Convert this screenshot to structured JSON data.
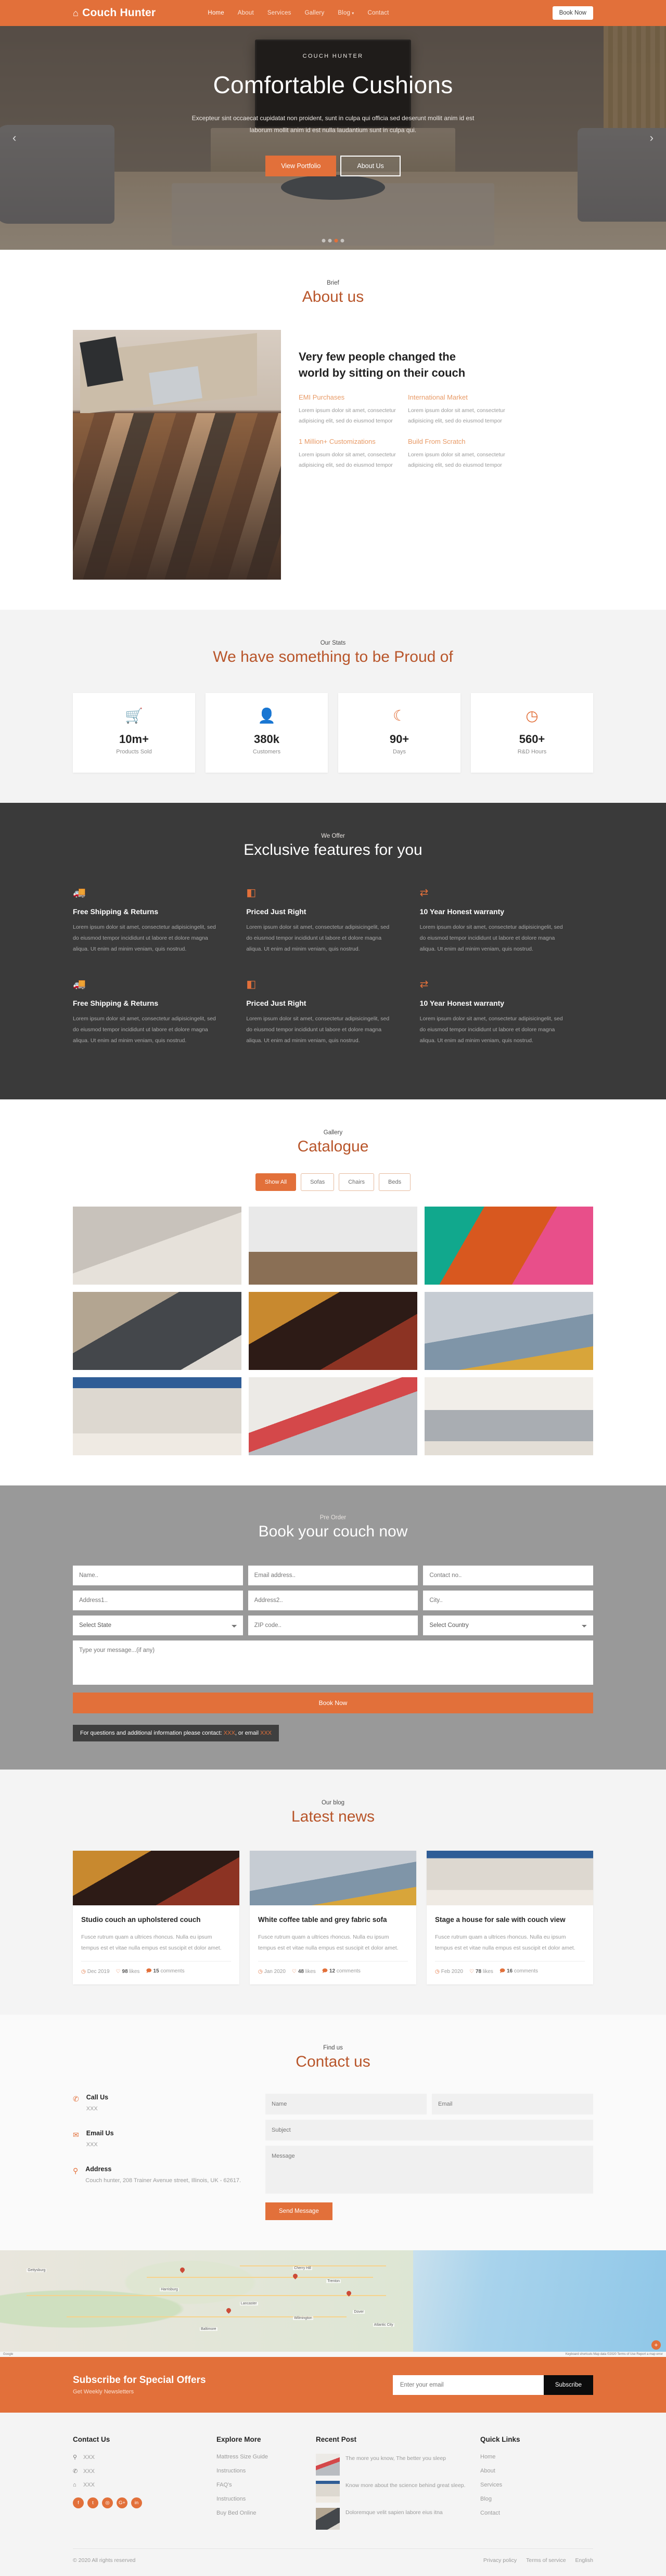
{
  "header": {
    "brand": "Couch Hunter",
    "brand_icon": "home-icon",
    "nav": [
      {
        "label": "Home",
        "active": true
      },
      {
        "label": "About",
        "active": false
      },
      {
        "label": "Services",
        "active": false
      },
      {
        "label": "Gallery",
        "active": false
      },
      {
        "label": "Blog",
        "active": false,
        "caret": "▾"
      },
      {
        "label": "Contact",
        "active": false
      }
    ],
    "book_now": "Book Now"
  },
  "hero": {
    "kicker": "COUCH HUNTER",
    "title": "Comfortable Cushions",
    "subtitle": "Excepteur sint occaecat cupidatat non proident, sunt in culpa qui officia sed deserunt mollit anim id est laborum mollit anim id est nulla laudantium sunt in culpa qui.",
    "primary_btn": "View Portfolio",
    "secondary_btn": "About Us",
    "prev": "‹",
    "next": "›",
    "slide_count": 4,
    "active_slide": 3
  },
  "about": {
    "kicker": "Brief",
    "headline": "About us",
    "heading": "Very few people changed the world by sitting on their couch",
    "cells": [
      {
        "title": "EMI Purchases",
        "text": "Lorem ipsum dolor sit amet, consectetur adipisicing elit, sed do eiusmod tempor"
      },
      {
        "title": "International Market",
        "text": "Lorem ipsum dolor sit amet, consectetur adipisicing elit, sed do eiusmod tempor"
      },
      {
        "title": "1 Million+ Customizations",
        "text": "Lorem ipsum dolor sit amet, consectetur adipisicing elit, sed do eiusmod tempor"
      },
      {
        "title": "Build From Scratch",
        "text": "Lorem ipsum dolor sit amet, consectetur adipisicing elit, sed do eiusmod tempor"
      }
    ]
  },
  "stats": {
    "kicker": "Our Stats",
    "headline": "We have something to be Proud of",
    "items": [
      {
        "icon": "shopping-cart-icon",
        "glyph": "🛒",
        "number": "10m+",
        "label": "Products Sold"
      },
      {
        "icon": "user-icon",
        "glyph": "👤",
        "number": "380k",
        "label": "Customers"
      },
      {
        "icon": "moon-icon",
        "glyph": "☾",
        "number": "90+",
        "label": "Days"
      },
      {
        "icon": "clock-icon",
        "glyph": "◷",
        "number": "560+",
        "label": "R&D Hours"
      }
    ]
  },
  "features": {
    "kicker": "We Offer",
    "headline": "Exclusive features for you",
    "body": "Lorem ipsum dolor sit amet, consectetur adipisicingelit, sed do eiusmod tempor incididunt ut labore et dolore magna aliqua. Ut enim ad minim veniam, quis nostrud.",
    "items": [
      {
        "icon": "truck-icon",
        "glyph": "🚚",
        "title": "Free Shipping & Returns"
      },
      {
        "icon": "price-tag-icon",
        "glyph": "◧",
        "title": "Priced Just Right"
      },
      {
        "icon": "exchange-icon",
        "glyph": "⇄",
        "title": "10 Year Honest warranty"
      },
      {
        "icon": "truck-icon",
        "glyph": "🚚",
        "title": "Free Shipping & Returns"
      },
      {
        "icon": "price-tag-icon",
        "glyph": "◧",
        "title": "Priced Just Right"
      },
      {
        "icon": "exchange-icon",
        "glyph": "⇄",
        "title": "10 Year Honest warranty"
      }
    ]
  },
  "gallery": {
    "kicker": "Gallery",
    "headline": "Catalogue",
    "filters": [
      {
        "label": "Show All",
        "active": true
      },
      {
        "label": "Sofas",
        "active": false
      },
      {
        "label": "Chairs",
        "active": false
      },
      {
        "label": "Beds",
        "active": false
      }
    ],
    "tiles": [
      {
        "name": "grey-and-cream-sofas",
        "color": "linear-gradient(160deg,#c8c2bb 0 48%,#e6e1da 48% 100%)"
      },
      {
        "name": "yellow-loveseat",
        "color": "linear-gradient(180deg,#e9e9e9 0 58%,#8a6f55 58% 100%)"
      },
      {
        "name": "pink-neon-lounge",
        "color": "linear-gradient(120deg,#11a88d 0 28%,#d8581f 28% 62%,#e84f8a 62% 100%)"
      },
      {
        "name": "dark-sectional-lounge",
        "color": "linear-gradient(150deg,#b3a591 0 35%,#44474b 35% 80%,#ded9d2 80% 100%)"
      },
      {
        "name": "antique-red-settee",
        "color": "linear-gradient(150deg,#c8892f 0 30%,#2d1b16 30% 68%,#8c3323 68% 100%)"
      },
      {
        "name": "blue-sofa-yellow-chair",
        "color": "linear-gradient(170deg,#c6ccd3 0 48%,#7f95a8 48% 78%,#d8a53a 78% 100%)"
      },
      {
        "name": "white-sofa-blue-blinds",
        "color": "linear-gradient(180deg,#2f5d96 0 14%,#ddd8d0 14% 72%,#efeae3 72% 100%)"
      },
      {
        "name": "grey-sofa-floral-art",
        "color": "linear-gradient(160deg,#eceae6 0 40%,#d4484a 40% 54%,#b9bcc1 54% 100%)"
      },
      {
        "name": "tufted-grey-sofa",
        "color": "linear-gradient(180deg,#f1eee9 0 42%,#a9adb2 42% 82%,#e3ded6 82% 100%)"
      }
    ]
  },
  "booking": {
    "kicker": "Pre Order",
    "headline": "Book your couch now",
    "fields": {
      "name": "Name..",
      "email": "Email address..",
      "contact": "Contact no..",
      "address1": "Address1..",
      "address2": "Address2..",
      "city": "City..",
      "state": "Select State",
      "zip": "ZIP code..",
      "country": "Select Country",
      "message": "Type your message...(if any)"
    },
    "submit": "Book Now",
    "note_prefix": "For questions and additional information please contact:",
    "note_contact": "XXX",
    "note_middle": ", or email",
    "note_email": "XXX"
  },
  "blog": {
    "kicker": "Our blog",
    "headline": "Latest news",
    "posts": [
      {
        "image": "antique-red-settee",
        "title": "Studio couch an upholstered couch",
        "excerpt": "Fusce rutrum quam a ultrices rhoncus. Nulla eu ipsum tempus est et vitae nulla empus est suscipit et dolor amet.",
        "date": "Dec 2019",
        "likes": "98",
        "likes_label": "likes",
        "comments": "15",
        "comments_label": "comments"
      },
      {
        "image": "blue-sofa-yellow-chair",
        "title": "White coffee table and grey fabric sofa",
        "excerpt": "Fusce rutrum quam a ultrices rhoncus. Nulla eu ipsum tempus est et vitae nulla empus est suscipit et dolor amet.",
        "date": "Jan 2020",
        "likes": "48",
        "likes_label": "likes",
        "comments": "12",
        "comments_label": "comments"
      },
      {
        "image": "white-sofa-blue-blinds",
        "title": "Stage a house for sale with couch view",
        "excerpt": "Fusce rutrum quam a ultrices rhoncus. Nulla eu ipsum tempus est et vitae nulla empus est suscipit et dolor amet.",
        "date": "Feb 2020",
        "likes": "78",
        "likes_label": "likes",
        "comments": "16",
        "comments_label": "comments"
      }
    ]
  },
  "contact": {
    "kicker": "Find us",
    "headline": "Contact us",
    "items": [
      {
        "icon": "phone-icon",
        "glyph": "✆",
        "title": "Call Us",
        "value": "XXX"
      },
      {
        "icon": "envelope-icon",
        "glyph": "✉",
        "title": "Email Us",
        "value": "XXX"
      },
      {
        "icon": "location-pin-icon",
        "glyph": "⚲",
        "title": "Address",
        "value": "Couch hunter, 208 Trainer Avenue street, Illinois, UK - 62617."
      }
    ],
    "form": {
      "name": "Name",
      "email": "Email",
      "subject": "Subject",
      "message": "Message",
      "submit": "Send Message"
    }
  },
  "map": {
    "zoom_control": "+",
    "attribution_left": "Google",
    "attribution_right": "Keyboard shortcuts    Map data ©2020    Terms of Use    Report a map error",
    "labels": [
      "Gettysburg",
      "Cherry Hill",
      "Harrisburg",
      "Lancaster",
      "Dover",
      "Trenton",
      "Atlantic City",
      "Wilmington",
      "Baltimore"
    ]
  },
  "newsletter": {
    "title": "Subscribe for Special Offers",
    "subtitle": "Get Weekly Newsletters",
    "placeholder": "Enter your email",
    "button": "Subscribe"
  },
  "footer": {
    "contact": {
      "title": "Contact Us",
      "lines": [
        {
          "icon": "location-pin-icon",
          "glyph": "⚲",
          "text": "XXX"
        },
        {
          "icon": "phone-icon",
          "glyph": "✆",
          "text": "XXX"
        },
        {
          "icon": "envelope-icon",
          "glyph": "⌂",
          "text": "XXX"
        }
      ],
      "social": [
        {
          "name": "facebook-icon",
          "glyph": "f"
        },
        {
          "name": "twitter-icon",
          "glyph": "t"
        },
        {
          "name": "instagram-icon",
          "glyph": "◎"
        },
        {
          "name": "google-plus-icon",
          "glyph": "G+"
        },
        {
          "name": "linkedin-icon",
          "glyph": "in"
        }
      ]
    },
    "explore": {
      "title": "Explore More",
      "links": [
        "Mattress Size Guide",
        "Instructions",
        "FAQ's",
        "Instructions",
        "Buy Bed Online"
      ]
    },
    "recent": {
      "title": "Recent Post",
      "posts": [
        {
          "image": "grey-sofa-floral-art",
          "text": "The more you know, The better you sleep"
        },
        {
          "image": "white-sofa-blue-blinds",
          "text": "Know more about the science behind great sleep."
        },
        {
          "image": "dark-sectional-lounge",
          "text": "Doloremque velit sapien labore eius itna"
        }
      ]
    },
    "quick": {
      "title": "Quick Links",
      "links": [
        "Home",
        "About",
        "Services",
        "Blog",
        "Contact"
      ]
    },
    "copyright": "© 2020 All rights reserved",
    "bottom_links": [
      "Privacy policy",
      "Terms of service",
      "English"
    ]
  },
  "colors": {
    "accent": "#e2703a",
    "headline": "#b8552a",
    "dark": "#3a3a3a",
    "grey": "#999999"
  }
}
